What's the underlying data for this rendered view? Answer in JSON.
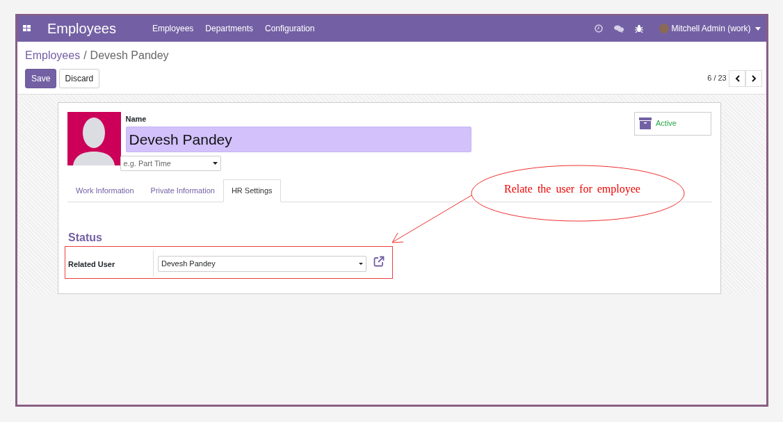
{
  "navbar": {
    "app_title": "Employees",
    "menu": [
      {
        "label": "Employees"
      },
      {
        "label": "Departments"
      },
      {
        "label": "Configuration"
      }
    ],
    "user": "Mitchell Admin (work)"
  },
  "breadcrumb": {
    "parent": "Employees",
    "separator": "/",
    "current": "Devesh Pandey"
  },
  "buttons": [
    {
      "label": "Save",
      "kind": "primary"
    },
    {
      "label": "Discard",
      "kind": "secondary"
    }
  ],
  "pager": "6 / 23",
  "form": {
    "name_label": "Name",
    "name_value": "Devesh Pandey",
    "job_placeholder": "e.g. Part Time",
    "active_label": "Active",
    "tabs": [
      {
        "label": "Work Information",
        "selected": false
      },
      {
        "label": "Private Information",
        "selected": false
      },
      {
        "label": "HR Settings",
        "selected": true
      }
    ],
    "section_title": "Status",
    "fields": [
      {
        "label": "Related User",
        "value": "Devesh Pandey",
        "highlighted": true
      }
    ]
  },
  "annotation": {
    "text": "Relate the user for employee"
  }
}
